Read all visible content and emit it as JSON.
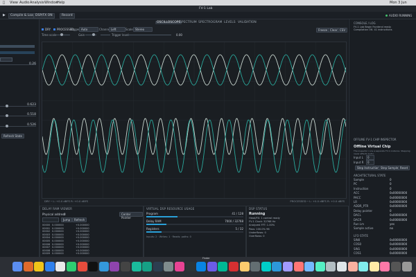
{
  "menubar": {
    "items": [
      "View",
      "Audio",
      "Analysis",
      "Window",
      "Help"
    ],
    "clock": "Mon 3 Jun"
  },
  "window": {
    "title": "FV-1 Lab"
  },
  "toolbar": {
    "compile_label": "Compile & Load",
    "toggle_label": "DSP/FX ON",
    "record_label": "Record",
    "status_label": "AUDIO RUNNING"
  },
  "center": {
    "tabs": [
      {
        "label": "OSCILLOSCOPE",
        "active": true
      },
      {
        "label": "SPECTRUM",
        "active": false
      },
      {
        "label": "SPECTROGRAM",
        "active": false
      },
      {
        "label": "LEVELS",
        "active": false
      },
      {
        "label": "VALIDATION",
        "active": false
      }
    ],
    "controls": {
      "dry_label": "DRY",
      "processed_label": "PROCESSED",
      "trigger_label": "Trigger",
      "trigger_value": "Auto",
      "channel_label": "Channel",
      "channel_value": "Left",
      "scale_label": "Scale",
      "scale_value": "Stereo",
      "timescale_label": "Time scale",
      "gain_label": "Gain",
      "level_label": "Trigger level",
      "level_value": "0.00",
      "freeze_label": "Freeze",
      "clear_label": "Clear",
      "csv_label": "CSV"
    },
    "scope_footer_left": "DRY ─ L: +0.0 dBFS R: +0.0 dBFS",
    "scope_footer_right": "PROCESSED ─ L: +0.0 dBFS R: +0.0 dBFS"
  },
  "bottom": {
    "delay": {
      "title": "DELAY RAM VIEWER",
      "address_label": "Physical address",
      "address_value": "0",
      "center_label": "Center Pointer",
      "jump_label": "Jump",
      "refresh_label": "Refresh",
      "rows": [
        {
          "addr": "00000",
          "val": "0.000000",
          "hex": "+0.000000"
        },
        {
          "addr": "00001",
          "val": "0.000000",
          "hex": "+0.000000"
        },
        {
          "addr": "00002",
          "val": "0.000000",
          "hex": "+0.000000"
        },
        {
          "addr": "00003",
          "val": "0.000000",
          "hex": "+0.000000"
        },
        {
          "addr": "00004",
          "val": "0.000000",
          "hex": "+0.000000"
        },
        {
          "addr": "00005",
          "val": "0.000000",
          "hex": "+0.000000"
        },
        {
          "addr": "00006",
          "val": "0.000000",
          "hex": "+0.000000"
        },
        {
          "addr": "00007",
          "val": "0.000000",
          "hex": "+0.000000"
        },
        {
          "addr": "00008",
          "val": "0.000000",
          "hex": "+0.000000"
        },
        {
          "addr": "00009",
          "val": "0.000000",
          "hex": "+0.000000"
        }
      ]
    },
    "resource": {
      "title": "VIRTUAL DSP RESOURCE USAGE",
      "program_label": "Program",
      "program_value": "41 / 128",
      "program_fraction": 0.32,
      "delay_label": "Delay RAM",
      "delay_value": "7000 / 32768",
      "delay_fraction": 0.21,
      "regs_label": "Registers",
      "regs_value": "5 / 32",
      "regs_fraction": 0.16,
      "footer": "Inputs: 2 · Writes: 1 · Reads: paths: 0"
    },
    "dsp": {
      "title": "DSP STATUS",
      "state": "Running",
      "lines": [
        "Head/FX: 1 control ready",
        "FV-1 Clock: 32768 Hz",
        "Analyzed FFT: 1.00%",
        "Pass: 100.0% 96",
        "Underflows: 0",
        "Overflows: 0"
      ]
    }
  },
  "right": {
    "console_title": "CONSOLE / LOG",
    "console_lines": [
      "FV-1 Lab Begin Frontend ready.",
      "Compilation OK: 41 instructions"
    ],
    "inspector_title": "OFFLINE FV-1 CHIP INSPECTOR",
    "virtual_title": "Offline Virtual Chip",
    "virtual_desc": "The inspector runs a separate FV-1 instance. Stepping never affects audio.",
    "input_l_label": "Input L",
    "input_l_value": "0",
    "input_r_label": "Input R",
    "input_r_value": "0",
    "step_instr_label": "Step Instruction",
    "step_sample_label": "Step Sample",
    "reset_label": "Reset",
    "arch_title": "ARCHITECTURAL STATE",
    "arch": [
      {
        "k": "Sample",
        "v": "0"
      },
      {
        "k": "PC",
        "v": "0"
      },
      {
        "k": "Instruction",
        "v": "0"
      },
      {
        "k": "ACC",
        "v": "0x00000000"
      },
      {
        "k": "PACC",
        "v": "0x00000000"
      },
      {
        "k": "LR",
        "v": "0x00000000"
      },
      {
        "k": "ADDR_PTR",
        "v": "0x00000000"
      },
      {
        "k": "Delay pointer",
        "v": "0"
      },
      {
        "k": "DACL",
        "v": "0x00000000"
      },
      {
        "k": "DACR",
        "v": "0x00000000"
      },
      {
        "k": "Run Lm",
        "v": "yes"
      },
      {
        "k": "Sample active",
        "v": "no"
      }
    ],
    "lfo_title": "LFO STATE",
    "lfo": [
      {
        "k": "SIN0",
        "v": "0x00000000"
      },
      {
        "k": "COS0",
        "v": "0x00000000"
      },
      {
        "k": "SIN1",
        "v": "0x00000000"
      },
      {
        "k": "COS1",
        "v": "0x00000000"
      }
    ]
  },
  "dock": {
    "label": "Finder"
  },
  "colors": {
    "wave_dry": "#c9d7d0",
    "wave_proc": "#2aa89c",
    "accent": "#3b82f6"
  }
}
